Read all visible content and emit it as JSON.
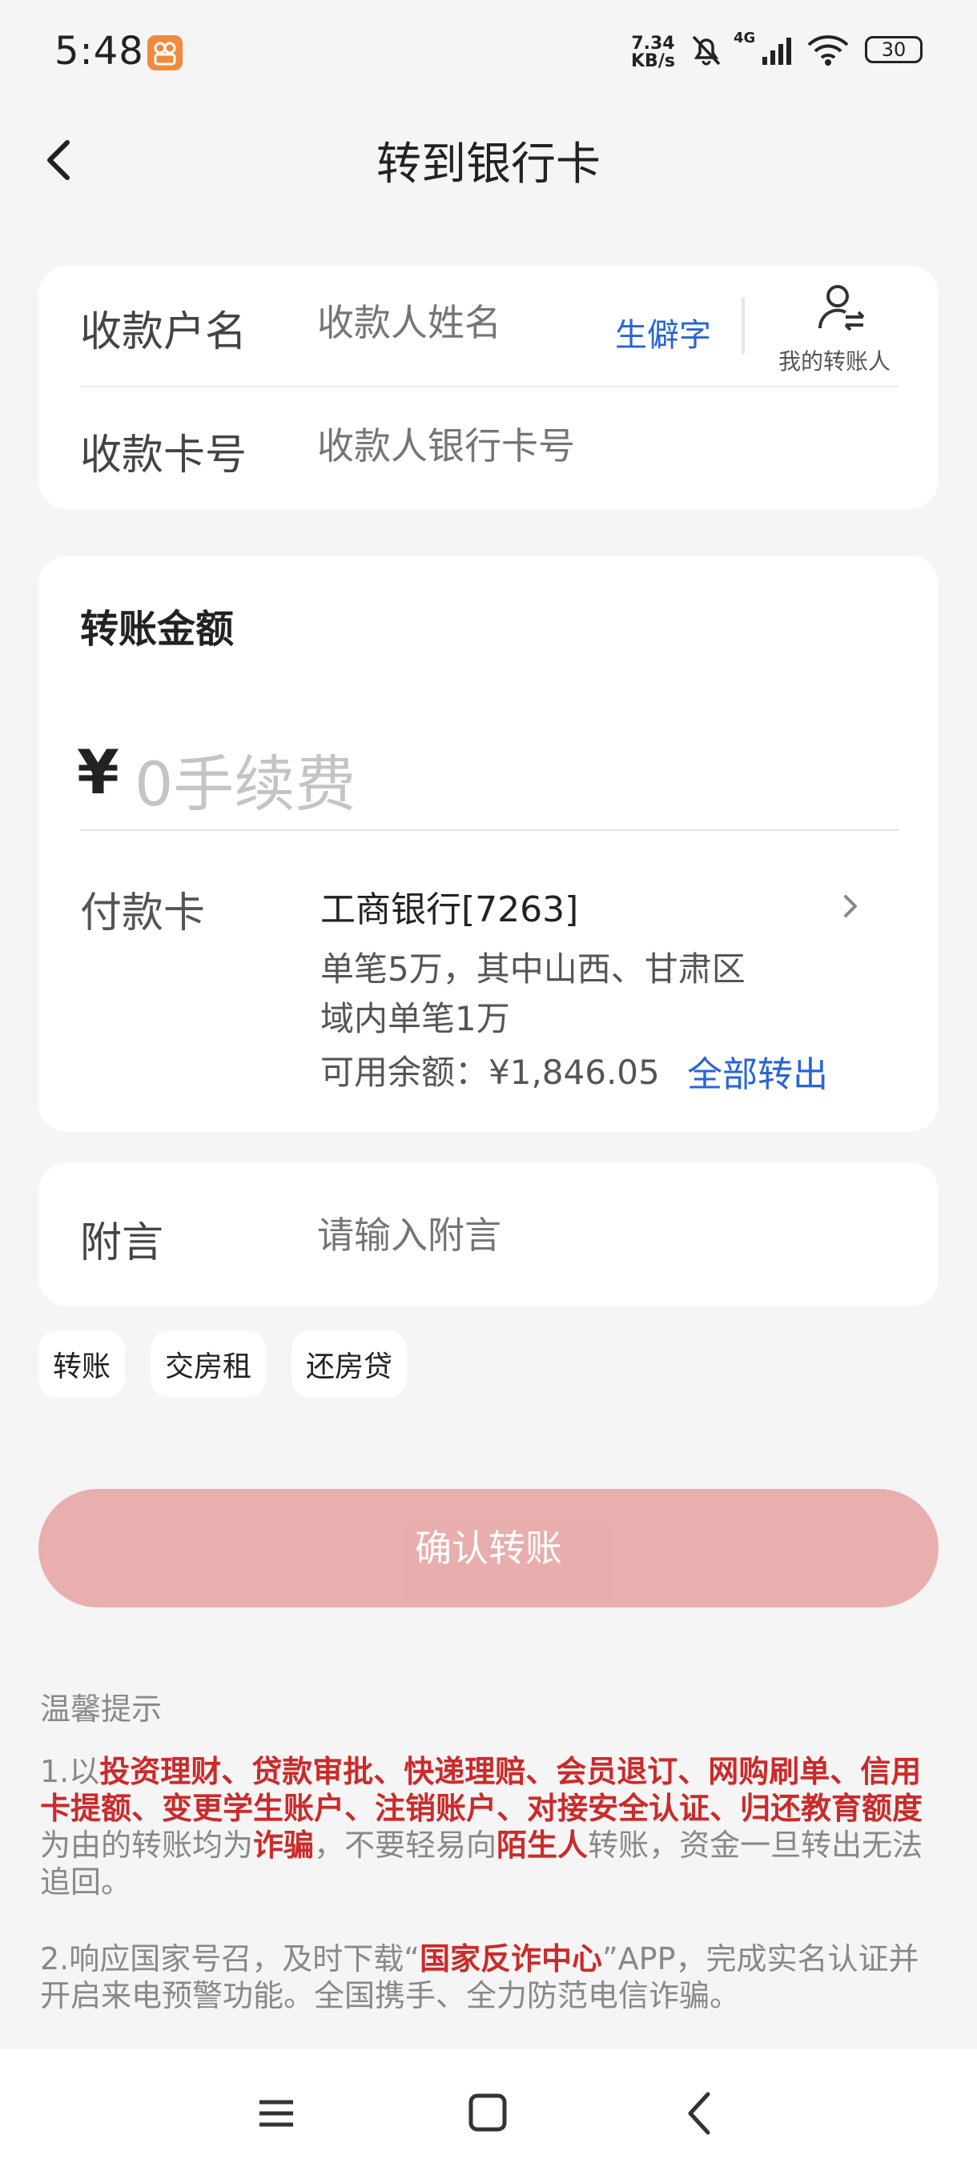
{
  "status_bar": {
    "time": "5:48",
    "net_speed_value": "7.34",
    "net_speed_unit": "KB/s",
    "signal": "4G",
    "battery": "30"
  },
  "header": {
    "title": "转到银行卡"
  },
  "payee": {
    "name_label": "收款户名",
    "name_placeholder": "收款人姓名",
    "rare_char": "生僻字",
    "my_payees": "我的转账人",
    "card_label": "收款卡号",
    "card_placeholder": "收款人银行卡号"
  },
  "amount": {
    "title": "转账金额",
    "currency": "¥",
    "placeholder": "0手续费"
  },
  "pay_card": {
    "label": "付款卡",
    "bank": "工商银行[7263]",
    "limit": "单笔5万，其中山西、甘肃区域内单笔1万",
    "balance": "可用余额：¥1,846.05",
    "transfer_all": "全部转出"
  },
  "memo": {
    "label": "附言",
    "placeholder": "请输入附言"
  },
  "chips": [
    "转账",
    "交房租",
    "还房贷"
  ],
  "confirm": "确认转账",
  "tips": {
    "title": "温馨提示",
    "tip1_a": "1.以",
    "tip1_b": "投资理财、贷款审批、快递理赔、会员退订、网购刷单、信用卡提额、变更学生账户、注销账户、对接安全认证、归还教育额度",
    "tip1_c": "为由的转账均为",
    "tip1_d": "诈骗",
    "tip1_e": "，不要轻易向",
    "tip1_f": "陌生人",
    "tip1_g": "转账，资金一旦转出无法追回。",
    "tip2_a": "2.响应国家号召，及时下载“",
    "tip2_b": "国家反诈中心",
    "tip2_c": "”APP，完成实名认证并开启来电预警功能。全国携手、全力防范电信诈骗。"
  },
  "colors": {
    "accent": "#2864d8",
    "warning": "#cc2a2a",
    "confirm_disabled": "#e8aaaa",
    "background": "#f5f5f5"
  }
}
